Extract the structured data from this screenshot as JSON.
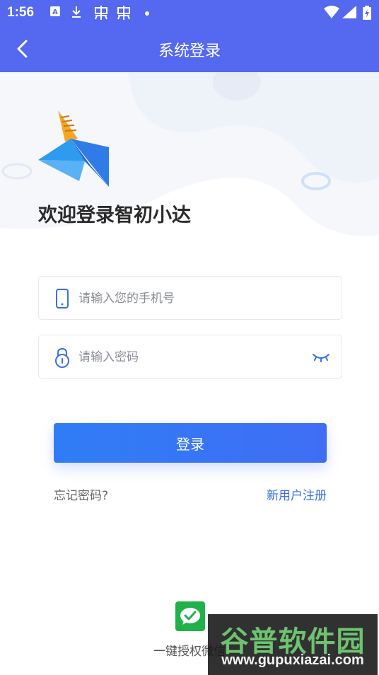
{
  "status_bar": {
    "time": "1:56",
    "left_icons": [
      "a-app-icon",
      "download-icon",
      "bug-icon",
      "bug-icon",
      "dot-icon"
    ],
    "right_icons": [
      "wifi-icon",
      "signal-icon",
      "battery-icon"
    ]
  },
  "nav": {
    "title": "系统登录",
    "back_icon": "chevron-left-icon"
  },
  "welcome": {
    "text": "欢迎登录智初小达"
  },
  "form": {
    "phone": {
      "placeholder": "请输入您的手机号",
      "value": "",
      "icon": "phone-icon"
    },
    "password": {
      "placeholder": "请输入密码",
      "value": "",
      "icon": "lock-icon",
      "toggle_icon": "eye-closed-icon"
    }
  },
  "actions": {
    "login_label": "登录",
    "forgot_label": "忘记密码?",
    "register_label": "新用户注册"
  },
  "wechat": {
    "label": "一键授权微信",
    "icon": "wechat-icon"
  },
  "watermark": {
    "title": "谷普软件园",
    "url": "www.gupuxiazai.com"
  },
  "colors": {
    "header": "#5468f0",
    "primary": "#3f6ef5",
    "link": "#3a6ee8",
    "wechat": "#21b14a"
  }
}
